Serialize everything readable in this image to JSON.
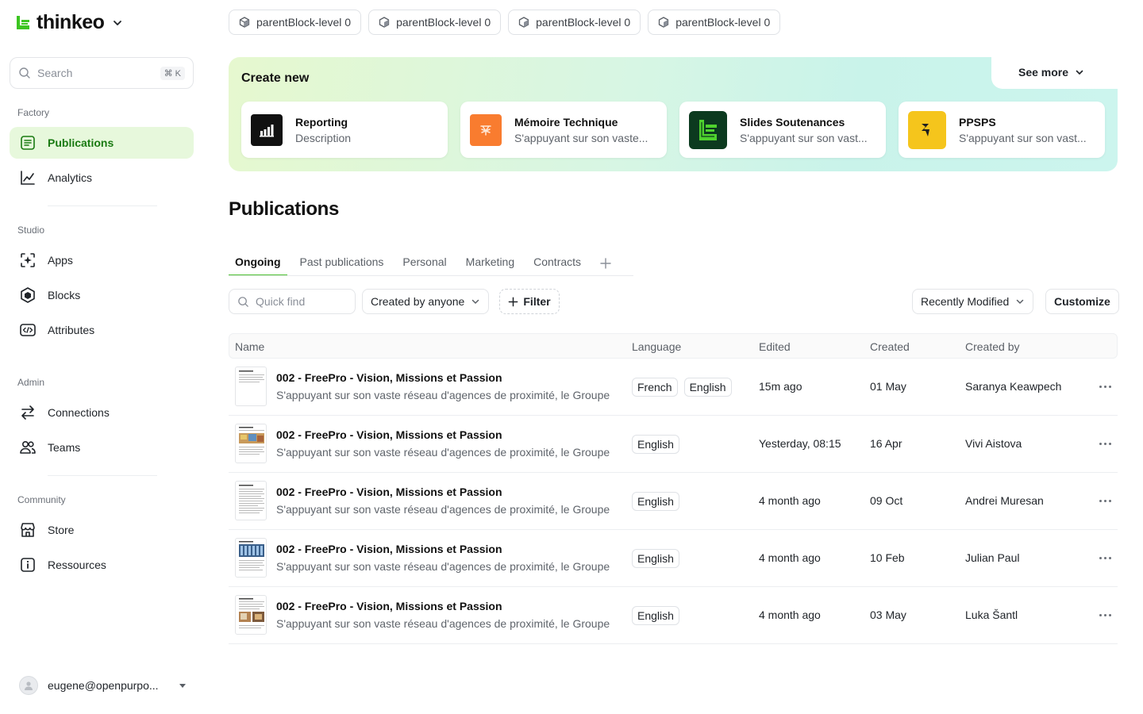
{
  "brand": {
    "name": "thinkeo"
  },
  "search": {
    "placeholder": "Search",
    "shortcut": "⌘ K"
  },
  "sidebar": {
    "sections": [
      {
        "label": "Factory",
        "items": [
          {
            "label": "Publications",
            "icon": "publications-icon",
            "active": true
          },
          {
            "label": "Analytics",
            "icon": "analytics-icon"
          }
        ]
      },
      {
        "label": "Studio",
        "items": [
          {
            "label": "Apps",
            "icon": "apps-icon"
          },
          {
            "label": "Blocks",
            "icon": "blocks-icon"
          },
          {
            "label": "Attributes",
            "icon": "attributes-icon"
          }
        ]
      },
      {
        "label": "Admin",
        "items": [
          {
            "label": "Connections",
            "icon": "connections-icon"
          },
          {
            "label": "Teams",
            "icon": "teams-icon"
          }
        ]
      },
      {
        "label": "Community",
        "items": [
          {
            "label": "Store",
            "icon": "store-icon"
          },
          {
            "label": "Ressources",
            "icon": "info-icon"
          }
        ]
      }
    ],
    "user_email": "eugene@openpurpo..."
  },
  "block_chips": [
    "parentBlock-level 0",
    "parentBlock-level 0",
    "parentBlock-level 0",
    "parentBlock-level 0"
  ],
  "create_new": {
    "title": "Create new",
    "see_more": "See more",
    "cards": [
      {
        "title": "Reporting",
        "description": "Description",
        "icon": "reporting-icon",
        "color": "#111111"
      },
      {
        "title": "Mémoire Technique",
        "description": "S'appuyant sur son vaste...",
        "icon": "memoire-icon",
        "color": "#f97c2f"
      },
      {
        "title": "Slides Soutenances",
        "description": "S'appuyant sur son vast...",
        "icon": "slides-icon",
        "color": "#0c3a1f"
      },
      {
        "title": "PPSPS",
        "description": "S'appuyant sur son vast...",
        "icon": "ppsps-icon",
        "color": "#f5c51c"
      }
    ]
  },
  "main": {
    "title": "Publications",
    "tabs": [
      {
        "label": "Ongoing",
        "active": true
      },
      {
        "label": "Past publications"
      },
      {
        "label": "Personal"
      },
      {
        "label": "Marketing"
      },
      {
        "label": "Contracts"
      }
    ],
    "toolbar": {
      "quick_find_placeholder": "Quick find",
      "created_by": "Created by anyone",
      "filter": "Filter",
      "sort": "Recently Modified",
      "customize": "Customize"
    },
    "table": {
      "columns": [
        "Name",
        "Language",
        "Edited",
        "Created",
        "Created by"
      ],
      "rows": [
        {
          "title": "002 - FreePro - Vision, Missions et Passion",
          "description": "S'appuyant sur son vaste réseau d'agences de proximité, le Groupe",
          "languages": [
            "French",
            "English"
          ],
          "edited": "15m ago",
          "created": "01 May",
          "created_by": "Saranya Keawpech",
          "thumb": "text"
        },
        {
          "title": "002 - FreePro - Vision, Missions et Passion",
          "description": "S'appuyant sur son vaste réseau d'agences de proximité, le Groupe",
          "languages": [
            "English"
          ],
          "edited": "Yesterday, 08:15",
          "created": "16 Apr",
          "created_by": "Vivi Aistova",
          "thumb": "image"
        },
        {
          "title": "002 - FreePro - Vision, Missions et Passion",
          "description": "S'appuyant sur son vaste réseau d'agences de proximité, le Groupe",
          "languages": [
            "English"
          ],
          "edited": "4 month ago",
          "created": "09 Oct",
          "created_by": "Andrei Muresan",
          "thumb": "text"
        },
        {
          "title": "002 - FreePro - Vision, Missions et Passion",
          "description": "S'appuyant sur son vaste réseau d'agences de proximité, le Groupe",
          "languages": [
            "English"
          ],
          "edited": "4 month ago",
          "created": "10 Feb",
          "created_by": "Julian Paul",
          "thumb": "building"
        },
        {
          "title": "002 - FreePro - Vision, Missions et Passion",
          "description": "S'appuyant sur son vaste réseau d'agences de proximité, le Groupe",
          "languages": [
            "English"
          ],
          "edited": "4 month ago",
          "created": "03 May",
          "created_by": "Luka Šantl",
          "thumb": "photos"
        }
      ]
    }
  },
  "colors": {
    "accent": "#4bbf2f",
    "active_bg": "#e7f8dc",
    "active_text": "#1a7a12"
  }
}
